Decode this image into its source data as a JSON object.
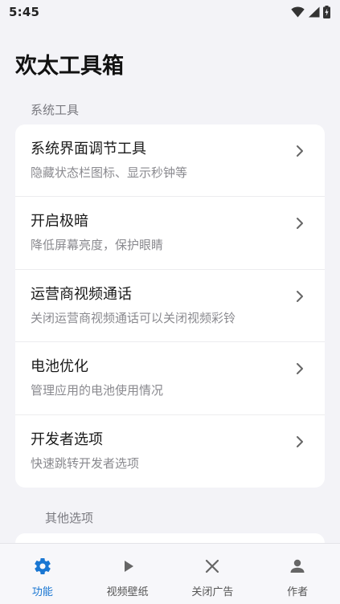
{
  "status_bar": {
    "time": "5:45",
    "icons": [
      "wifi-icon",
      "signal-icon",
      "battery-charging-icon"
    ]
  },
  "app": {
    "title": "欢太工具箱"
  },
  "sections": [
    {
      "label": "系统工具",
      "items": [
        {
          "title": "系统界面调节工具",
          "subtitle": "隐藏状态栏图标、显示秒钟等"
        },
        {
          "title": "开启极暗",
          "subtitle": "降低屏幕亮度，保护眼睛"
        },
        {
          "title": "运营商视频通话",
          "subtitle": "关闭运营商视频通话可以关闭视频彩铃"
        },
        {
          "title": "电池优化",
          "subtitle": "管理应用的电池使用情况"
        },
        {
          "title": "开发者选项",
          "subtitle": "快速跳转开发者选项"
        }
      ]
    },
    {
      "label": "其他选项",
      "items": []
    }
  ],
  "bottom_nav": [
    {
      "label": "功能",
      "icon": "gear-icon",
      "active": true
    },
    {
      "label": "视频壁纸",
      "icon": "play-icon",
      "active": false
    },
    {
      "label": "关闭广告",
      "icon": "close-icon",
      "active": false
    },
    {
      "label": "作者",
      "icon": "person-icon",
      "active": false
    }
  ],
  "colors": {
    "accent": "#1976d2",
    "background": "#f3f3f7",
    "card": "#ffffff",
    "subtitle": "#8a8a8f"
  }
}
